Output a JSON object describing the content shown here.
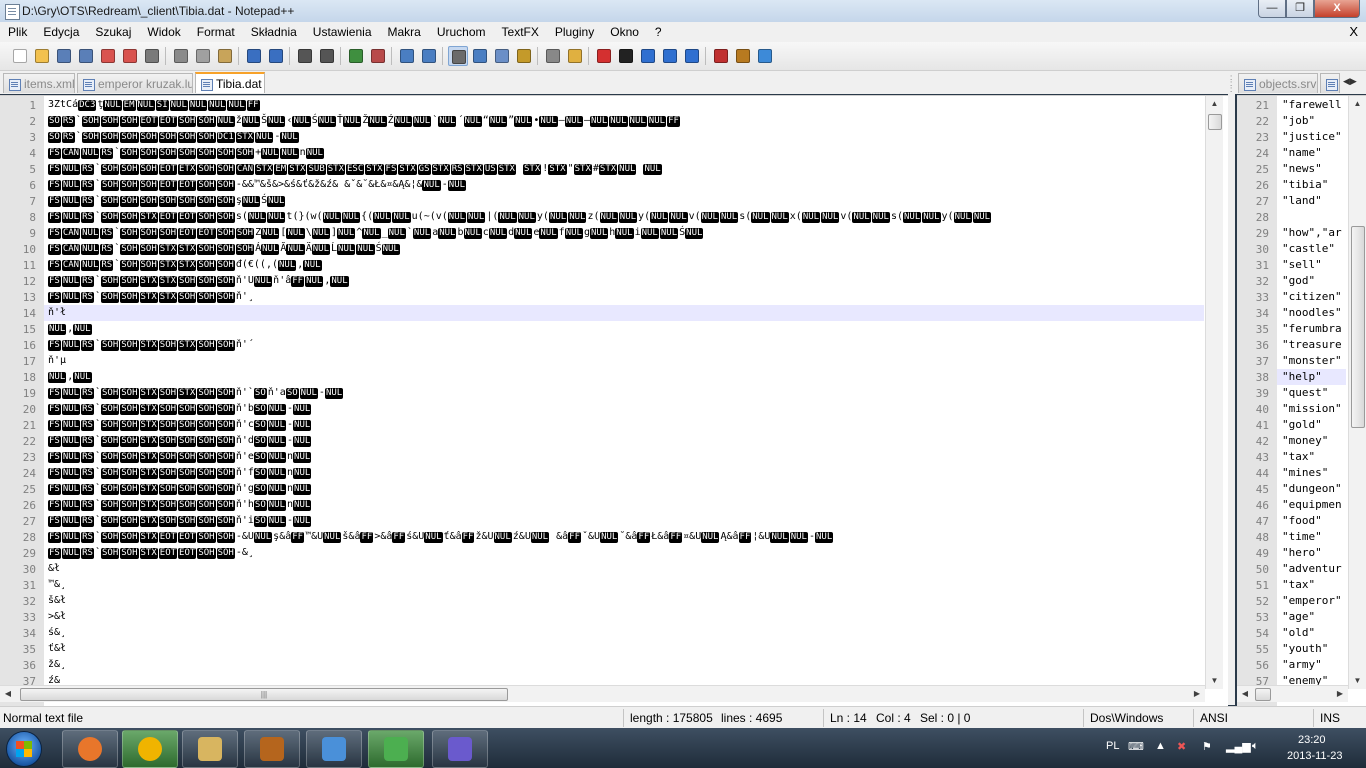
{
  "window": {
    "title": "D:\\Gry\\OTS\\Redream\\_client\\Tibia.dat - Notepad++",
    "minimize": "—",
    "maximize": "❐",
    "close": "X",
    "menu_close": "X"
  },
  "menu": [
    "Plik",
    "Edycja",
    "Szukaj",
    "Widok",
    "Format",
    "Składnia",
    "Ustawienia",
    "Makra",
    "Uruchom",
    "TextFX",
    "Pluginy",
    "Okno",
    "?"
  ],
  "toolbar_icons": [
    "new-file-icon",
    "open-file-icon",
    "save-icon",
    "save-all-icon",
    "close-icon",
    "close-all-icon",
    "print-icon",
    "cut-icon",
    "copy-icon",
    "paste-icon",
    "undo-icon",
    "redo-icon",
    "find-icon",
    "replace-icon",
    "zoom-in-icon",
    "zoom-out-icon",
    "sync-v-icon",
    "sync-h-icon",
    "word-wrap-icon",
    "all-chars-icon",
    "indent-guide-icon",
    "doc-map-icon",
    "function-list-icon",
    "folder-icon",
    "record-macro-icon",
    "stop-macro-icon",
    "play-macro-icon",
    "run-macro-icon",
    "save-macro-icon",
    "spellcheck-icon",
    "spell-options-icon",
    "spell-toggle-icon"
  ],
  "tabs_left": [
    {
      "label": "items.xml",
      "active": false
    },
    {
      "label": "emperor kruzak.lua",
      "active": false
    },
    {
      "label": "Tibia.dat",
      "active": true
    }
  ],
  "tabs_right": [
    {
      "label": "objects.srv",
      "active": false
    }
  ],
  "left_editor": {
    "current_line": 14,
    "lines": [
      {
        "n": "1",
        "t": "3ZtCá[DC3]ţ[NUL][EM][NUL][SI][NUL][NUL][NUL][NUL][FF]"
      },
      {
        "n": "2",
        "t": "[SO][RS]`[SOH][SOH][SOH][EOT][EOT][SOH][SOH][NUL]ž[NUL]Š[NUL]‹[NUL]Ś[NUL]Ť[NUL]Ž[NUL]Ź[NUL][NUL]`[NUL]´[NUL]“[NUL]”[NUL]•[NUL]–[NUL]—[NUL][NUL][NUL][NUL][FF]"
      },
      {
        "n": "3",
        "t": "[SO][RS]`[SOH][SOH][SOH][SOH][SOH][SOH][SOH][DC1][STX][NUL]-[NUL]"
      },
      {
        "n": "4",
        "t": "[FS][CAN][NUL][RS]`[SOH][SOH][SOH][SOH][SOH][SOH][SOH]+[NUL][NUL]n[NUL]"
      },
      {
        "n": "5",
        "t": "[FS][NUL][RS]`[SOH][SOH][SOH][EOT][ETX][SOH][SOH][CAN][STX][EM][STX][SUB][STX][ESC][STX][FS][STX][GS][STX][RS][STX][US][STX] [STX]![STX]\"[STX]#[STX][NUL] [NUL]"
      },
      {
        "n": "6",
        "t": "[FS][NUL][RS]`[SOH][SOH][SOH][EOT][EOT][SOH][SOH]-&&™&š&>&ś&ť&ž&ź& &ˇ&˘&Ł&¤&Ą&¦&[NUL]-[NUL]"
      },
      {
        "n": "7",
        "t": "[FS][NUL][RS]`[SOH][SOH][SOH][SOH][SOH][SOH][SOH]ş[NUL]Ś[NUL]"
      },
      {
        "n": "8",
        "t": "[FS][NUL][RS]`[SOH][SOH][STX][EOT][EOT][SOH][SOH]s([NUL][NUL]t(}(w([NUL][NUL]{([NUL][NUL]u(~(v([NUL][NUL]|([NUL][NUL]y([NUL][NUL]z([NUL][NUL]y([NUL][NUL]v([NUL][NUL]s([NUL][NUL]x([NUL][NUL]v([NUL][NUL]s([NUL][NUL]y([NUL][NUL]"
      },
      {
        "n": "9",
        "t": "[FS][CAN][NUL][RS]`[SOH][SOH][SOH][EOT][EOT][SOH][SOH]Z[NUL][[NUL]\\[NUL]][NUL]^[NUL]_[NUL]`[NUL]a[NUL]b[NUL]c[NUL]d[NUL]e[NUL]f[NUL]g[NUL]h[NUL]i[NUL][NUL]Ś[NUL]"
      },
      {
        "n": "10",
        "t": "[FS][CAN][NUL][RS]`[SOH][SOH][STX][STX][SOH][SOH][SOH]Á[NUL]Ă[NUL]Ä[NUL]Ĺ[NUL][NUL]Ś[NUL]"
      },
      {
        "n": "11",
        "t": "[FS][CAN][NUL][RS]`[SOH][SOH][STX][STX][SOH][SOH]đ(€((,([NUL],[NUL]"
      },
      {
        "n": "12",
        "t": "[FS][NUL][RS]`[SOH][SOH][STX][STX][SOH][SOH][SOH]ň'U[NUL]ň'â[FF][NUL],[NUL]"
      },
      {
        "n": "13",
        "t": "[FS][NUL][RS]`[SOH][SOH][STX][STX][SOH][SOH][SOH]ň'¸"
      },
      {
        "n": "14",
        "t": "ň'ł"
      },
      {
        "n": "15",
        "t": "[NUL],[NUL]"
      },
      {
        "n": "16",
        "t": "[FS][NUL][RS]`[SOH][SOH][STX][SOH][STX][SOH][SOH]ň'´"
      },
      {
        "n": "17",
        "t": "ň'µ"
      },
      {
        "n": "18",
        "t": "[NUL],[NUL]"
      },
      {
        "n": "19",
        "t": "[FS][NUL][RS]`[SOH][SOH][STX][SOH][STX][SOH][SOH]ň'`[SO]ň'a[SO][NUL]-[NUL]"
      },
      {
        "n": "20",
        "t": "[FS][NUL][RS]`[SOH][SOH][STX][SOH][SOH][SOH][SOH]ň'b[SO][NUL]-[NUL]"
      },
      {
        "n": "21",
        "t": "[FS][NUL][RS]`[SOH][SOH][STX][SOH][SOH][SOH][SOH]ň'c[SO][NUL]-[NUL]"
      },
      {
        "n": "22",
        "t": "[FS][NUL][RS]`[SOH][SOH][STX][SOH][SOH][SOH][SOH]ň'd[SO][NUL]-[NUL]"
      },
      {
        "n": "23",
        "t": "[FS][NUL][RS]`[SOH][SOH][STX][SOH][SOH][SOH][SOH]ň'e[SO][NUL]n[NUL]"
      },
      {
        "n": "24",
        "t": "[FS][NUL][RS]`[SOH][SOH][STX][SOH][SOH][SOH][SOH]ň'f[SO][NUL]n[NUL]"
      },
      {
        "n": "25",
        "t": "[FS][NUL][RS]`[SOH][SOH][STX][SOH][SOH][SOH][SOH]ň'g[SO][NUL]n[NUL]"
      },
      {
        "n": "26",
        "t": "[FS][NUL][RS]`[SOH][SOH][STX][SOH][SOH][SOH][SOH]ň'h[SO][NUL]n[NUL]"
      },
      {
        "n": "27",
        "t": "[FS][NUL][RS]`[SOH][SOH][STX][SOH][SOH][SOH][SOH]ň'i[SO][NUL]-[NUL]"
      },
      {
        "n": "28",
        "t": "[FS][NUL][RS]`[SOH][SOH][STX][EOT][EOT][SOH][SOH]-&U[NUL]ş&â[FF]™&U[NUL]š&â[FF]>&â[FF]ś&U[NUL]ť&â[FF]ž&U[NUL]ź&U[NUL] &â[FF]ˇ&U[NUL]˘&â[FF]Ł&â[FF]¤&U[NUL]Ą&â[FF]¦&U[NUL][NUL]-[NUL]"
      },
      {
        "n": "29",
        "t": "[FS][NUL][RS]`[SOH][SOH][STX][EOT][EOT][SOH][SOH]-&¸"
      },
      {
        "n": "30",
        "t": "&ł"
      },
      {
        "n": "31",
        "t": "™&¸"
      },
      {
        "n": "32",
        "t": "š&ł"
      },
      {
        "n": "33",
        "t": ">&ł"
      },
      {
        "n": "34",
        "t": "ś&¸"
      },
      {
        "n": "35",
        "t": "ť&ł"
      },
      {
        "n": "36",
        "t": "ž&¸"
      },
      {
        "n": "37",
        "t": "ź&"
      }
    ]
  },
  "right_editor": {
    "current_line": 38,
    "lines": [
      {
        "n": "21",
        "t": "\"farewell"
      },
      {
        "n": "22",
        "t": "\"job\""
      },
      {
        "n": "23",
        "t": "\"justice\""
      },
      {
        "n": "24",
        "t": "\"name\""
      },
      {
        "n": "25",
        "t": "\"news\""
      },
      {
        "n": "26",
        "t": "\"tibia\""
      },
      {
        "n": "27",
        "t": "\"land\""
      },
      {
        "n": "28",
        "t": ""
      },
      {
        "n": "29",
        "t": "\"how\",\"ar"
      },
      {
        "n": "30",
        "t": "\"castle\""
      },
      {
        "n": "31",
        "t": "\"sell\""
      },
      {
        "n": "32",
        "t": "\"god\""
      },
      {
        "n": "33",
        "t": "\"citizen\""
      },
      {
        "n": "34",
        "t": "\"noodles\""
      },
      {
        "n": "35",
        "t": "\"ferumbra"
      },
      {
        "n": "36",
        "t": "\"treasure"
      },
      {
        "n": "37",
        "t": "\"monster\""
      },
      {
        "n": "38",
        "t": "\"help\""
      },
      {
        "n": "39",
        "t": "\"quest\""
      },
      {
        "n": "40",
        "t": "\"mission\""
      },
      {
        "n": "41",
        "t": "\"gold\""
      },
      {
        "n": "42",
        "t": "\"money\""
      },
      {
        "n": "43",
        "t": "\"tax\""
      },
      {
        "n": "44",
        "t": "\"mines\""
      },
      {
        "n": "45",
        "t": "\"dungeon\""
      },
      {
        "n": "46",
        "t": "\"equipmen"
      },
      {
        "n": "47",
        "t": "\"food\""
      },
      {
        "n": "48",
        "t": "\"time\""
      },
      {
        "n": "49",
        "t": "\"hero\""
      },
      {
        "n": "50",
        "t": "\"adventur"
      },
      {
        "n": "51",
        "t": "\"tax\""
      },
      {
        "n": "52",
        "t": "\"emperor\""
      },
      {
        "n": "53",
        "t": "\"age\""
      },
      {
        "n": "54",
        "t": "\"old\""
      },
      {
        "n": "55",
        "t": "\"youth\""
      },
      {
        "n": "56",
        "t": "\"army\""
      },
      {
        "n": "57",
        "t": "\"enemy\""
      }
    ]
  },
  "status": {
    "filetype": "Normal text file",
    "length": "length : 175805",
    "lines": "lines : 4695",
    "ln": "Ln : 14",
    "col": "Col : 4",
    "sel": "Sel : 0 | 0",
    "eol": "Dos\\Windows",
    "encoding": "ANSI",
    "mode": "INS"
  },
  "taskbar": {
    "apps": [
      "firefox-icon",
      "tunngle-icon",
      "explorer-folder-icon",
      "squirrel-icon",
      "paint-icon",
      "notepad-plus-plus-icon",
      "connect-icon"
    ],
    "language": "PL",
    "time": "23:20",
    "date": "2013-11-23"
  }
}
